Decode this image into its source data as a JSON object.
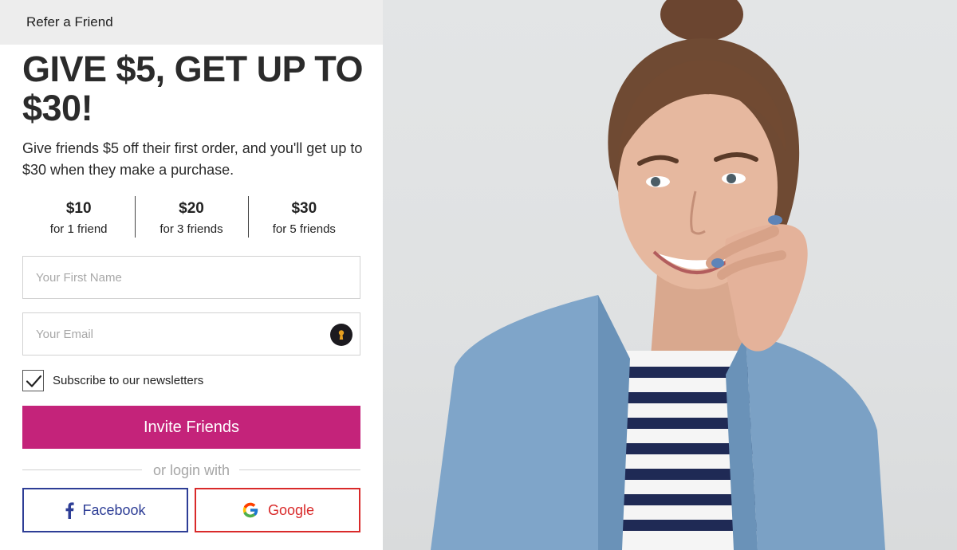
{
  "tab": {
    "label": "Refer a Friend"
  },
  "headline": "GIVE $5, GET UP TO $30!",
  "subtext": "Give friends $5 off their first order, and you'll get up to $30 when they make a purchase.",
  "tiers": [
    {
      "amount": "$10",
      "desc": "for 1 friend"
    },
    {
      "amount": "$20",
      "desc": "for 3 friends"
    },
    {
      "amount": "$30",
      "desc": "for 5 friends"
    }
  ],
  "form": {
    "first_name_placeholder": "Your First Name",
    "email_placeholder": "Your Email",
    "newsletter_label": "Subscribe to our newsletters",
    "newsletter_checked": true,
    "submit_label": "Invite Friends"
  },
  "divider_text": "or login with",
  "social": {
    "facebook_label": "Facebook",
    "google_label": "Google"
  },
  "colors": {
    "accent": "#c4237a",
    "facebook": "#2e3e96",
    "google": "#d92a2a"
  },
  "hero": {
    "image_icon": "photo-of-smiling-woman"
  }
}
